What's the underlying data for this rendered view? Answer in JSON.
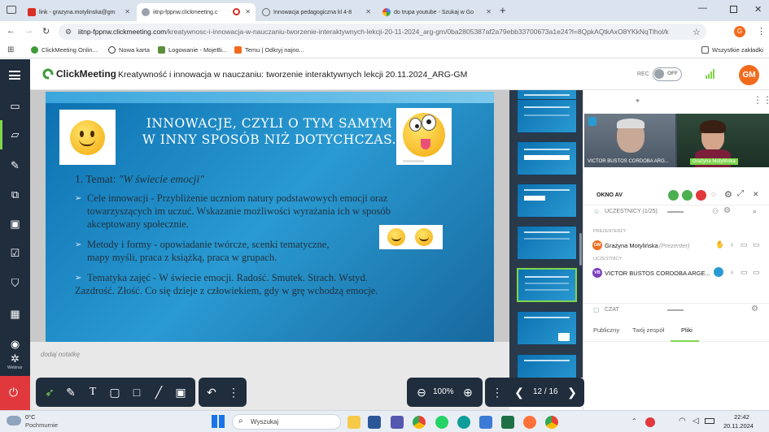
{
  "browser": {
    "tabs": [
      {
        "label": "link - grazyna.motylinska@gm",
        "active": false
      },
      {
        "label": "iitnp-fppnw.clickmeeting.c",
        "active": true
      },
      {
        "label": "Innowacja pedagogiczna kl 4-8",
        "active": false
      },
      {
        "label": "do trupa youtube - Szukaj w Go",
        "active": false
      }
    ],
    "new_tab": "+",
    "url_host": "iitnp-fppnw.clickmeeting.com",
    "url_path": "/kreatywnosc-i-innowacja-w-nauczaniu-tworzenie-interaktywnych-lekcji-20-11-2024_arg-gm/0ba2805387af2a79ebb33700673a1e24?l=8QpkAQtkAxO8YKkNqTlhol/k",
    "bookmarks": [
      {
        "label": "ClickMeeting Onlin...",
        "color": "#3f9a3a"
      },
      {
        "label": "Nowa karta",
        "color": "#333333"
      },
      {
        "label": "Logowanie - MojeBi...",
        "color": "#5b8f3a"
      },
      {
        "label": "Temu | Odkryj najno...",
        "color": "#f26b1d"
      }
    ],
    "all_bookmarks": "Wszystkie zakładki",
    "profile_initial": "G"
  },
  "app": {
    "logo": "ClickMeeting",
    "title": "Kreatywność i innowacja w nauczaniu: tworzenie interaktywnych lekcji 20.11.2024_ARG-GM",
    "rec_label": "REC",
    "rec_toggle": "OFF",
    "avatar_initials": "GM",
    "avatar_color": "#f26b1d",
    "accent": "#7fd64b"
  },
  "slide": {
    "title_line1": "INNOWACJE, CZYLI O TYM SAMYM",
    "title_line2": "W INNY SPOSÓB NIŻ DOTYCHCZAS.",
    "topic_prefix": "1. Temat: ",
    "topic_italic": "\"W świecie emocji\"",
    "b1_l1": "Cele innowacji - Przybliżenie uczniom natury podstawowych emocji oraz",
    "b1_l2": "towarzyszących im uczuć. Wskazanie możliwości wyrażania ich w sposób",
    "b1_l3": "akceptowany społecznie.",
    "b2_l1": "Metody i formy - opowiadanie twórcze, scenki tematyczne,",
    "b2_l2": "mapy myśli, praca z książką, praca w grupach.",
    "b3_l1": "Tematyka zajęć - W świecie emocji. Radość. Smutek. Strach. Wstyd.",
    "b3_l2": "Zazdrość. Złość. Co się dzieje z człowiekiem, gdy w grę wchodzą emocje.",
    "bullet_glyph": "➢"
  },
  "notes_placeholder": "dodaj notatkę",
  "rail": {
    "webinar_label": "Webinar"
  },
  "toolbar": {
    "zoom": "100%",
    "page": "12 / 16"
  },
  "video": {
    "person1": "VICTOR BUSTOS CORDOBA ARG...",
    "person2": "Grażyna Motylińska",
    "okno_av": "OKNO AV"
  },
  "participants": {
    "header": "UCZESTNICY (1/25)",
    "presenters_label": "PREZENTERZY",
    "presenter_name": "Grażyna Motylińska",
    "presenter_role": "(Prezenter)",
    "presenter_initials": "GM",
    "attendees_label": "UCZESTNICY",
    "attendee_name": "VICTOR BUSTOS CORDOBA ARGE...",
    "attendee_initials": "VB"
  },
  "chat": {
    "header": "CZAT",
    "tabs": [
      "Publiczny",
      "Twój zespół",
      "Pliki"
    ]
  },
  "taskbar": {
    "weather_temp": "0°C",
    "weather_desc": "Pochmurnie",
    "search": "Wyszukaj",
    "time": "22:42",
    "date": "20.11.2024"
  }
}
